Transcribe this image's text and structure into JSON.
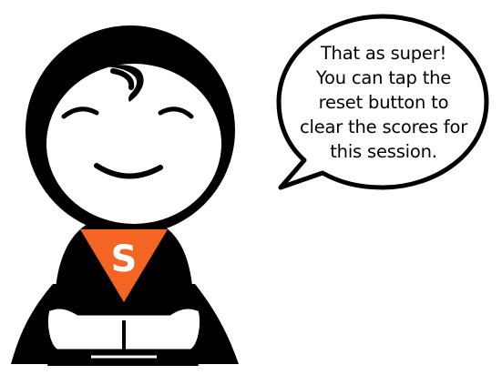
{
  "speech_bubble": {
    "lines": [
      "That as super!",
      "You can tap the",
      "reset button to",
      "clear the scores for",
      "this session."
    ]
  },
  "mascot": {
    "emblem_letter": "S",
    "colors": {
      "outline": "#000000",
      "skin": "#ffffff",
      "emblem": "#f26522",
      "emblem_letter": "#ffffff"
    }
  }
}
